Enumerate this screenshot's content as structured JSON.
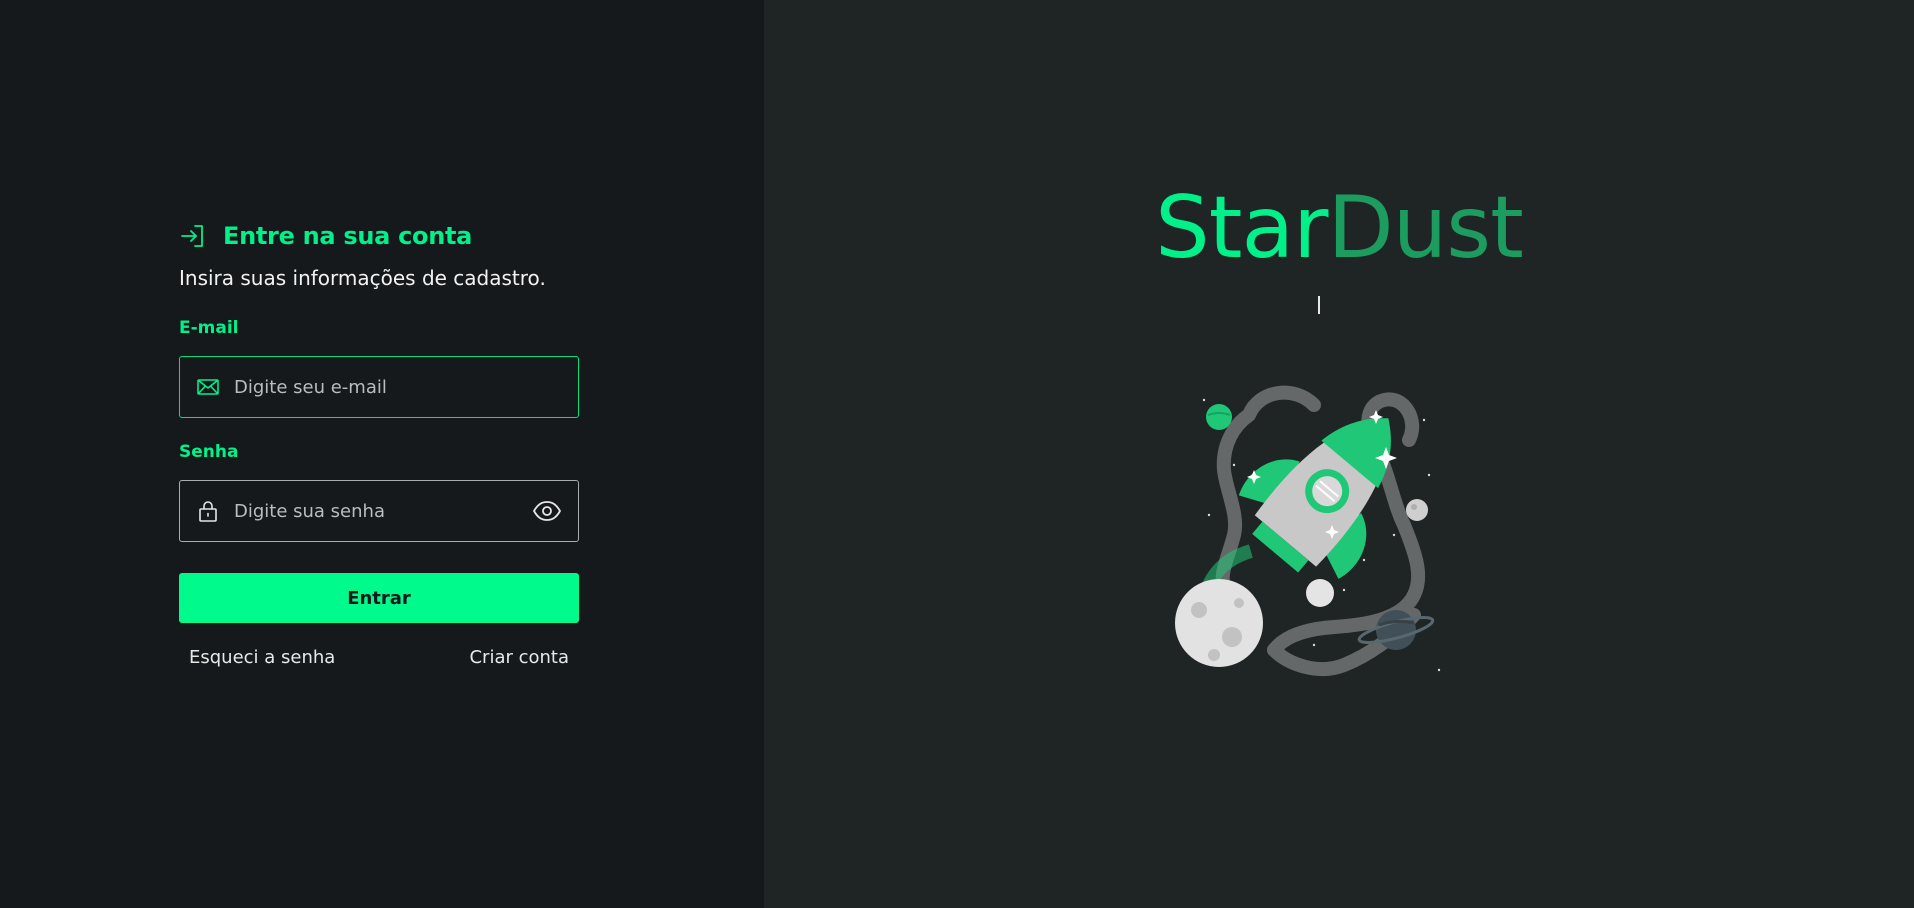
{
  "login": {
    "title": "Entre na sua conta",
    "subtitle": "Insira suas informações de cadastro.",
    "email_label": "E-mail",
    "email_placeholder": "Digite seu e-mail",
    "email_value": "",
    "password_label": "Senha",
    "password_placeholder": "Digite sua senha",
    "password_value": "",
    "submit_label": "Entrar",
    "forgot_label": "Esqueci a senha",
    "register_label": "Criar conta"
  },
  "brand": {
    "part1": "Star",
    "part2": "Dust"
  },
  "icons": {
    "login": "login-arrow-icon",
    "email": "envelope-icon",
    "password": "lock-icon",
    "reveal": "eye-icon"
  },
  "colors": {
    "accent": "#00f08a",
    "accent_dark": "#1c9c5f",
    "left_bg": "#16191c",
    "right_bg": "#1f2524"
  }
}
